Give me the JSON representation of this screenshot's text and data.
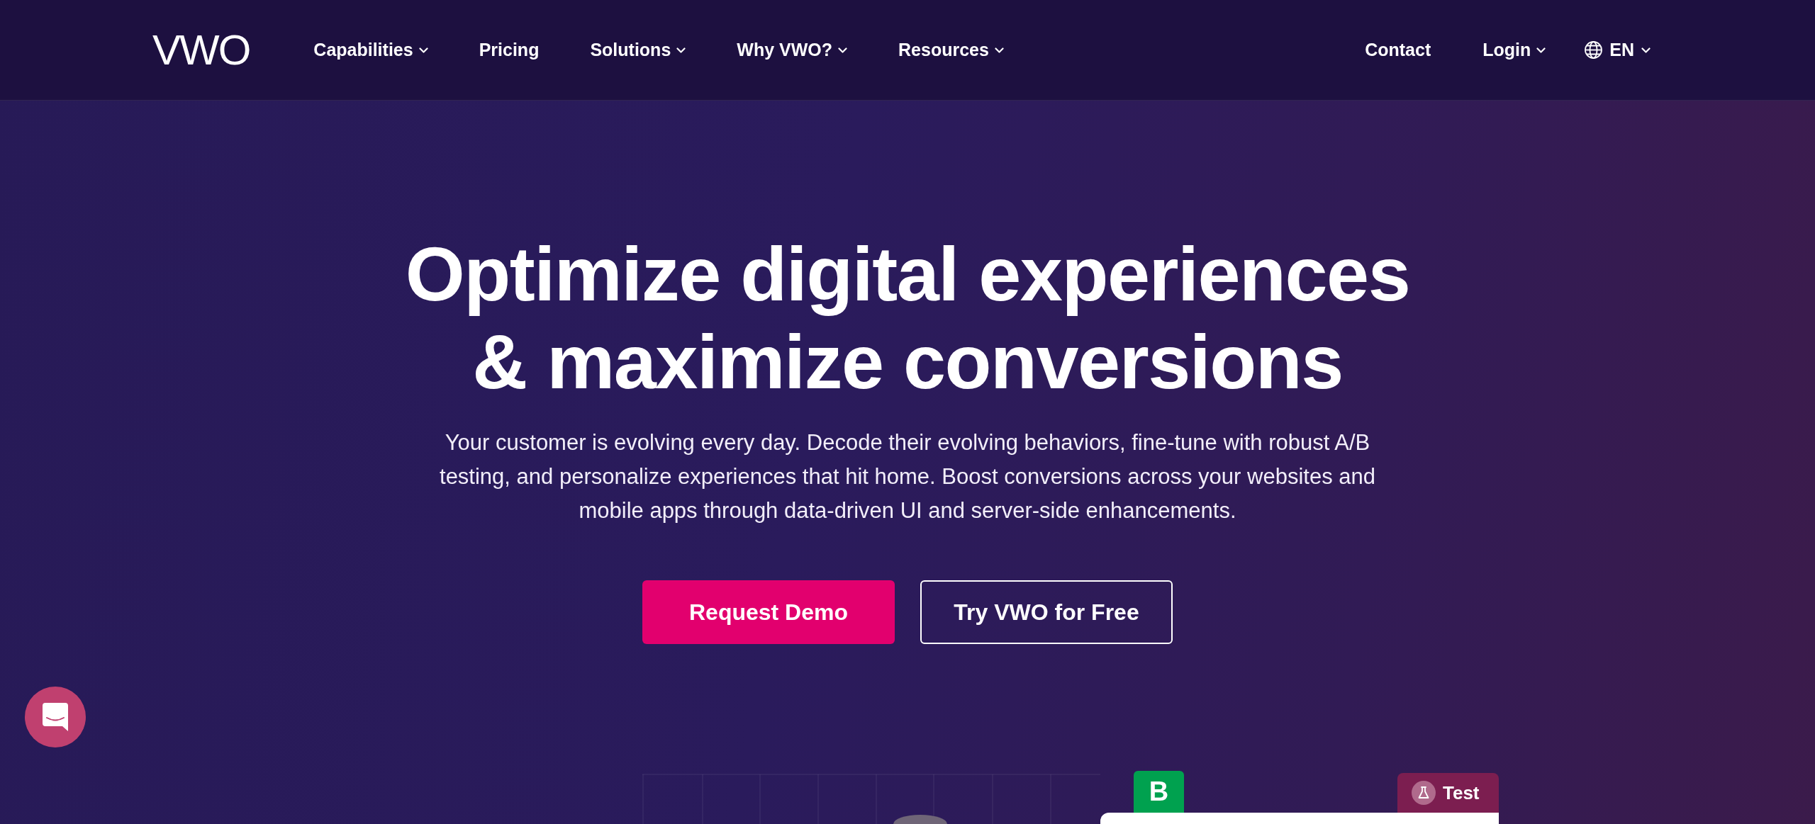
{
  "nav": {
    "logo": "VWO",
    "links": [
      {
        "label": "Capabilities",
        "has_menu": true
      },
      {
        "label": "Pricing",
        "has_menu": false
      },
      {
        "label": "Solutions",
        "has_menu": true
      },
      {
        "label": "Why VWO?",
        "has_menu": true
      },
      {
        "label": "Resources",
        "has_menu": true
      }
    ],
    "actions": [
      {
        "label": "Contact",
        "has_menu": false
      },
      {
        "label": "Login",
        "has_menu": true
      }
    ],
    "language": {
      "label": "EN",
      "has_menu": true
    }
  },
  "hero": {
    "title": "Optimize digital experiences & maximize conversions",
    "description": "Your customer is evolving every day. Decode their evolving behaviors, fine-tune with robust A/B testing, and personalize experiences that hit home. Boost conversions across your websites and mobile apps through data-driven UI and server-side enhancements.",
    "buttons": [
      {
        "label": "Request Demo",
        "kind": "primary"
      },
      {
        "label": "Try VWO for Free",
        "kind": "outline"
      }
    ]
  },
  "preview": {
    "variant_badge": "B",
    "tag": "Test"
  }
}
